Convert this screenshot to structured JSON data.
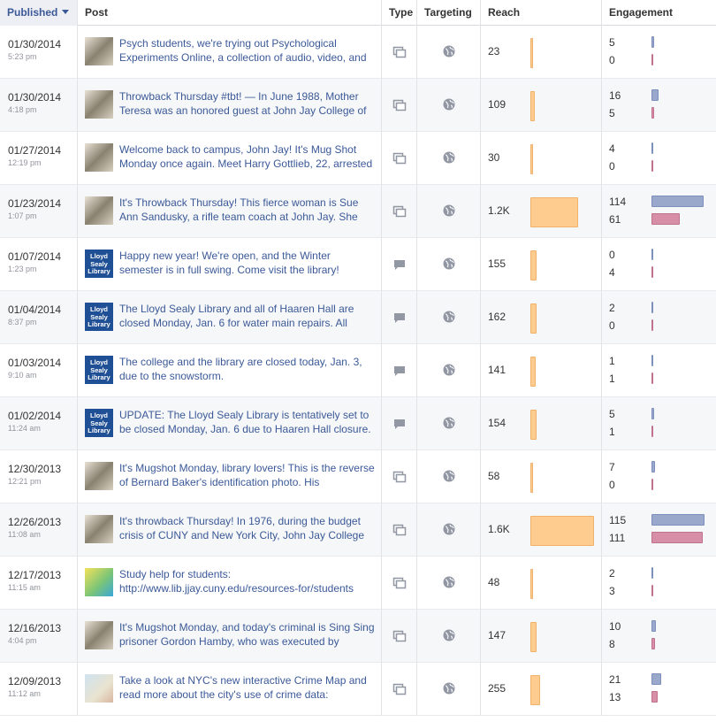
{
  "header": {
    "published": "Published",
    "post": "Post",
    "type": "Type",
    "targeting": "Targeting",
    "reach": "Reach",
    "engagement": "Engagement"
  },
  "rows": [
    {
      "date": "01/30/2014",
      "time": "5:23 pm",
      "text": "Psych students, we're trying out Psychological Experiments Online, a collection of audio, video, and",
      "type": "link",
      "thumb": "photo",
      "reach": "23",
      "reach_value": 23,
      "eng_top": "5",
      "eng_bottom": "0"
    },
    {
      "date": "01/30/2014",
      "time": "4:18 pm",
      "text": "Throwback Thursday #tbt! — In June 1988, Mother Teresa was an honored guest at John Jay College of",
      "type": "link",
      "thumb": "photo",
      "reach": "109",
      "reach_value": 109,
      "eng_top": "16",
      "eng_bottom": "5"
    },
    {
      "date": "01/27/2014",
      "time": "12:19 pm",
      "text": "Welcome back to campus, John Jay! It's Mug Shot Monday once again. Meet Harry Gottlieb, 22, arrested",
      "type": "link",
      "thumb": "photo",
      "reach": "30",
      "reach_value": 30,
      "eng_top": "4",
      "eng_bottom": "0"
    },
    {
      "date": "01/23/2014",
      "time": "1:07 pm",
      "text": "It's Throwback Thursday! This fierce woman is Sue Ann Sandusky, a rifle team coach at John Jay. She",
      "type": "link",
      "thumb": "photo",
      "reach": "1.2K",
      "reach_value": 1200,
      "eng_top": "114",
      "eng_bottom": "61"
    },
    {
      "date": "01/07/2014",
      "time": "1:23 pm",
      "text": "Happy new year! We're open, and the Winter semester is in full swing. Come visit the library!",
      "type": "status",
      "thumb": "lib",
      "reach": "155",
      "reach_value": 155,
      "eng_top": "0",
      "eng_bottom": "4"
    },
    {
      "date": "01/04/2014",
      "time": "8:37 pm",
      "text": "The Lloyd Sealy Library and all of Haaren Hall are closed Monday, Jan. 6 for water main repairs. All",
      "type": "status",
      "thumb": "lib",
      "reach": "162",
      "reach_value": 162,
      "eng_top": "2",
      "eng_bottom": "0"
    },
    {
      "date": "01/03/2014",
      "time": "9:10 am",
      "text": "The college and the library are closed today, Jan. 3, due to the snowstorm.",
      "type": "status",
      "thumb": "lib",
      "reach": "141",
      "reach_value": 141,
      "eng_top": "1",
      "eng_bottom": "1"
    },
    {
      "date": "01/02/2014",
      "time": "11:24 am",
      "text": "UPDATE: The Lloyd Sealy Library is tentatively set to be closed Monday, Jan. 6 due to Haaren Hall closure.",
      "type": "status",
      "thumb": "lib",
      "reach": "154",
      "reach_value": 154,
      "eng_top": "5",
      "eng_bottom": "1"
    },
    {
      "date": "12/30/2013",
      "time": "12:21 pm",
      "text": "It's Mugshot Monday, library lovers! This is the reverse of Bernard Baker's identification photo. His",
      "type": "link",
      "thumb": "photo",
      "reach": "58",
      "reach_value": 58,
      "eng_top": "7",
      "eng_bottom": "0"
    },
    {
      "date": "12/26/2013",
      "time": "11:08 am",
      "text": "It's throwback Thursday! In 1976, during the budget crisis of CUNY and New York City, John Jay College",
      "type": "link",
      "thumb": "photo",
      "reach": "1.6K",
      "reach_value": 1600,
      "eng_top": "115",
      "eng_bottom": "111"
    },
    {
      "date": "12/17/2013",
      "time": "11:15 am",
      "text": "Study help for students: http://www.lib.jjay.cuny.edu/resources-for/students",
      "type": "link",
      "thumb": "green",
      "reach": "48",
      "reach_value": 48,
      "eng_top": "2",
      "eng_bottom": "3"
    },
    {
      "date": "12/16/2013",
      "time": "4:04 pm",
      "text": "It's Mugshot Monday, and today's criminal is Sing Sing prisoner Gordon Hamby, who was executed by",
      "type": "link",
      "thumb": "photo",
      "reach": "147",
      "reach_value": 147,
      "eng_top": "10",
      "eng_bottom": "8"
    },
    {
      "date": "12/09/2013",
      "time": "11:12 am",
      "text": "Take a look at NYC's new interactive Crime Map and read more about the city's use of crime data:",
      "type": "link",
      "thumb": "map",
      "reach": "255",
      "reach_value": 255,
      "eng_top": "21",
      "eng_bottom": "13"
    }
  ],
  "library_logo": [
    "Lloyd",
    "Sealy",
    "Library"
  ],
  "colors": {
    "link": "#3b5998",
    "reach_bar": "#ffcc8f",
    "eng_blue": "#9aa8cc",
    "eng_pink": "#d68fa6"
  }
}
